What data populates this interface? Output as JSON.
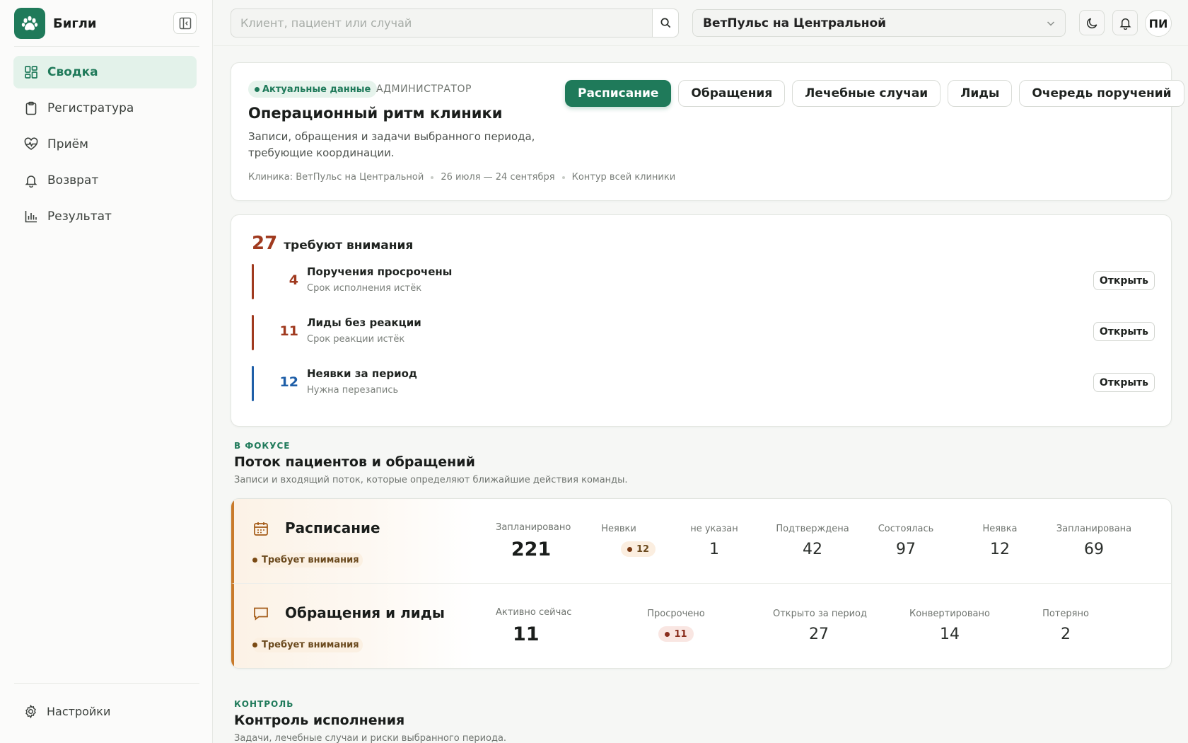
{
  "app": {
    "name": "Бигли"
  },
  "sidebar": {
    "items": [
      {
        "label": "Сводка",
        "icon": "dashboard-icon",
        "active": true
      },
      {
        "label": "Регистратура",
        "icon": "clipboard-icon"
      },
      {
        "label": "Приём",
        "icon": "heart-pulse-icon"
      },
      {
        "label": "Возврат",
        "icon": "bell-icon"
      },
      {
        "label": "Результат",
        "icon": "bar-chart-icon"
      }
    ],
    "settings_label": "Настройки"
  },
  "topbar": {
    "search_placeholder": "Клиент, пациент или случай",
    "clinic": "ВетПульс на Центральной",
    "avatar_initials": "ПИ"
  },
  "hero": {
    "badge": "Актуальные данные",
    "role": "АДМИНИСТРАТОР",
    "title": "Операционный ритм клиники",
    "description": "Записи, обращения и задачи выбранного периода, требующие координации.",
    "meta": [
      "Клиника: ВетПульс на Центральной",
      "26 июля — 24 сентября",
      "Контур всей клиники"
    ],
    "tabs": [
      {
        "label": "Расписание",
        "active": true
      },
      {
        "label": "Обращения"
      },
      {
        "label": "Лечебные случаи"
      },
      {
        "label": "Лиды"
      },
      {
        "label": "Очередь поручений"
      }
    ]
  },
  "attention": {
    "count": "27",
    "label": "требуют внимания",
    "items": [
      {
        "count": "4",
        "title": "Поручения просрочены",
        "subtitle": "Срок исполнения истёк",
        "color": "#a03a1f",
        "action": "Открыть"
      },
      {
        "count": "11",
        "title": "Лиды без реакции",
        "subtitle": "Срок реакции истёк",
        "color": "#a03a1f",
        "action": "Открыть"
      },
      {
        "count": "12",
        "title": "Неявки за период",
        "subtitle": "Нужна перезапись",
        "color": "#1f5fa8",
        "action": "Открыть"
      }
    ]
  },
  "focus": {
    "kicker": "В ФОКУСЕ",
    "title": "Поток пациентов и обращений",
    "description": "Записи и входящий поток, которые определяют ближайшие действия команды.",
    "rows": [
      {
        "name": "Расписание",
        "badge": "Требует внимания",
        "primary": {
          "label": "Запланировано",
          "value": "221"
        },
        "alert": {
          "label": "Неявки",
          "value": "12"
        },
        "metrics": [
          {
            "label": "не указан",
            "value": "1"
          },
          {
            "label": "Подтверждена",
            "value": "42"
          },
          {
            "label": "Состоялась",
            "value": "97"
          },
          {
            "label": "Неявка",
            "value": "12"
          },
          {
            "label": "Запланирована",
            "value": "69"
          }
        ]
      },
      {
        "name": "Обращения и лиды",
        "badge": "Требует внимания",
        "primary": {
          "label": "Активно сейчас",
          "value": "11"
        },
        "alert": {
          "label": "Просрочено",
          "value": "11"
        },
        "metrics": [
          {
            "label": "Открыто за период",
            "value": "27"
          },
          {
            "label": "Конвертировано",
            "value": "14"
          },
          {
            "label": "Потеряно",
            "value": "2"
          }
        ]
      }
    ]
  },
  "control": {
    "kicker": "КОНТРОЛЬ",
    "title": "Контроль исполнения",
    "description": "Задачи, лечебные случаи и риски выбранного периода."
  },
  "colors": {
    "accent": "#1f7a5a",
    "warning": "#c97a2a",
    "danger": "#a03a1f",
    "info": "#1f5fa8"
  }
}
